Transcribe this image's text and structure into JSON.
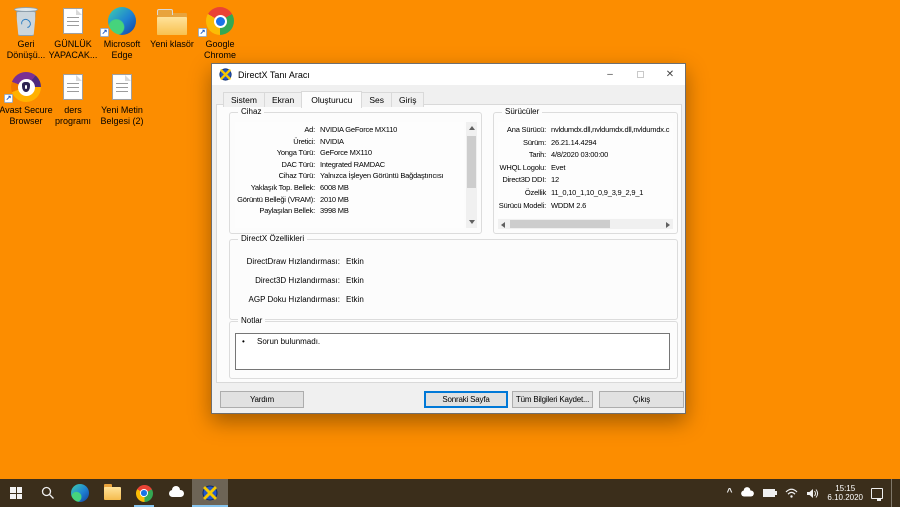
{
  "desktop": {
    "icons": [
      {
        "label": "Geri Dönüşü..."
      },
      {
        "label": "GÜNLÜK YAPACAK..."
      },
      {
        "label": "Microsoft Edge"
      },
      {
        "label": "Yeni klasör"
      },
      {
        "label": "Google Chrome"
      },
      {
        "label": "Avast Secure Browser"
      },
      {
        "label": "ders programı"
      },
      {
        "label": "Yeni Metin Belgesi (2)"
      }
    ]
  },
  "dialog": {
    "title": "DirectX Tanı Aracı",
    "controls": {
      "minimize": "–",
      "close": "✕"
    },
    "tabs": [
      "Sistem",
      "Ekran",
      "Oluşturucu",
      "Ses",
      "Giriş"
    ],
    "active_tab": "Oluşturucu",
    "device": {
      "title": "Cihaz",
      "rows": [
        {
          "label": "Ad:",
          "value": "NVIDIA GeForce MX110"
        },
        {
          "label": "Üretici:",
          "value": "NVIDIA"
        },
        {
          "label": "Yonga Türü:",
          "value": "GeForce MX110"
        },
        {
          "label": "DAC Türü:",
          "value": "Integrated RAMDAC"
        },
        {
          "label": "Cihaz Türü:",
          "value": "Yalnızca İşleyen Görüntü Bağdaştırıcısı"
        },
        {
          "label": "Yaklaşık Top. Bellek:",
          "value": "6008 MB"
        },
        {
          "label": "Görüntü Belleği (VRAM):",
          "value": "2010 MB"
        },
        {
          "label": "Paylaşılan Bellek:",
          "value": "3998 MB"
        }
      ]
    },
    "drivers": {
      "title": "Sürücüler",
      "rows": [
        {
          "label": "Ana Sürücü:",
          "value": "nvldumdx.dll,nvldumdx.dll,nvldumdx.c"
        },
        {
          "label": "Sürüm:",
          "value": "26.21.14.4294"
        },
        {
          "label": "Tarih:",
          "value": "4/8/2020 03:00:00"
        },
        {
          "label": "WHQL Logolu:",
          "value": "Evet"
        },
        {
          "label": "Direct3D DDI:",
          "value": "12"
        },
        {
          "label": "Özellik",
          "value": "11_0,10_1,10_0,9_3,9_2,9_1"
        },
        {
          "label": "Sürücü Modeli:",
          "value": "WDDM 2.6"
        }
      ]
    },
    "features": {
      "title": "DirectX Özellikleri",
      "rows": [
        {
          "label": "DirectDraw Hızlandırması:",
          "value": "Etkin"
        },
        {
          "label": "Direct3D Hızlandırması:",
          "value": "Etkin"
        },
        {
          "label": "AGP Doku Hızlandırması:",
          "value": "Etkin"
        }
      ]
    },
    "notes": {
      "title": "Notlar",
      "bullet": "•",
      "text": "Sorun bulunmadı."
    },
    "buttons": {
      "help": "Yardım",
      "next": "Sonraki Sayfa",
      "save": "Tüm Bilgileri Kaydet...",
      "exit": "Çıkış"
    }
  },
  "taskbar": {
    "clock": {
      "time": "15:15",
      "date": "6.10.2020"
    }
  },
  "colors": {
    "desktop_background": "#fc8d00",
    "taskbar_background": "#3b2e1b",
    "focus_border": "#0078d7",
    "running_underline": "#86c4ee"
  }
}
